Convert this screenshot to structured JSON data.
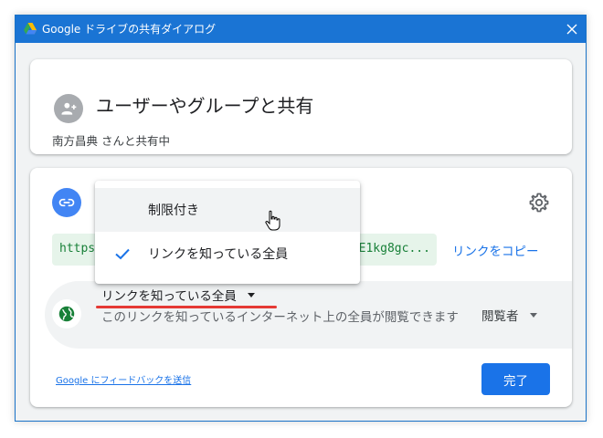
{
  "window": {
    "title": "Google ドライブの共有ダイアログ",
    "close_glyph": "✕"
  },
  "share": {
    "title": "ユーザーやグループと共有",
    "subtitle": "南方昌典 さんと共有中",
    "icon": "person-add-icon"
  },
  "link": {
    "icon": "link-icon",
    "url_start": "https:/",
    "url_end": "0iE1kg8gc...",
    "copy_label": "リンクをコピー",
    "settings_icon": "gear-icon",
    "access": {
      "selected": "リンクを知っている全員",
      "description": "このリンクを知っているインターネット上の全員が閲覧できます",
      "role": "閲覧者",
      "icon": "globe-icon"
    },
    "feedback_label": "Google にフィードバックを送信",
    "done_label": "完了"
  },
  "dropdown": {
    "items": [
      {
        "label": "制限付き",
        "checked": false,
        "hover": true
      },
      {
        "label": "リンクを知っている全員",
        "checked": true,
        "hover": false
      }
    ]
  },
  "colors": {
    "titlebar": "#1a74d4",
    "accent": "#1a73e8",
    "url_bg": "#e6f4ea",
    "url_text": "#188038",
    "underline": "#e53935"
  }
}
